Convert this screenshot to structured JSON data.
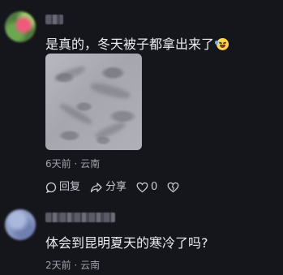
{
  "comments": [
    {
      "text": "是真的，冬天被子都拿出来了",
      "emoji_icon": "laughing-tears-emoji",
      "time": "6天前",
      "location": "云南",
      "separator": "·",
      "actions": {
        "reply_label": "回复",
        "share_label": "分享",
        "like_count": "0"
      }
    },
    {
      "text": "体会到昆明夏天的寒冷了吗?",
      "time": "2天前",
      "location": "云南",
      "separator": "·"
    }
  ],
  "colors": {
    "background": "#15161c",
    "text": "#ececf0",
    "meta_text": "#a0a1ab",
    "action_text": "#c9cad2"
  }
}
